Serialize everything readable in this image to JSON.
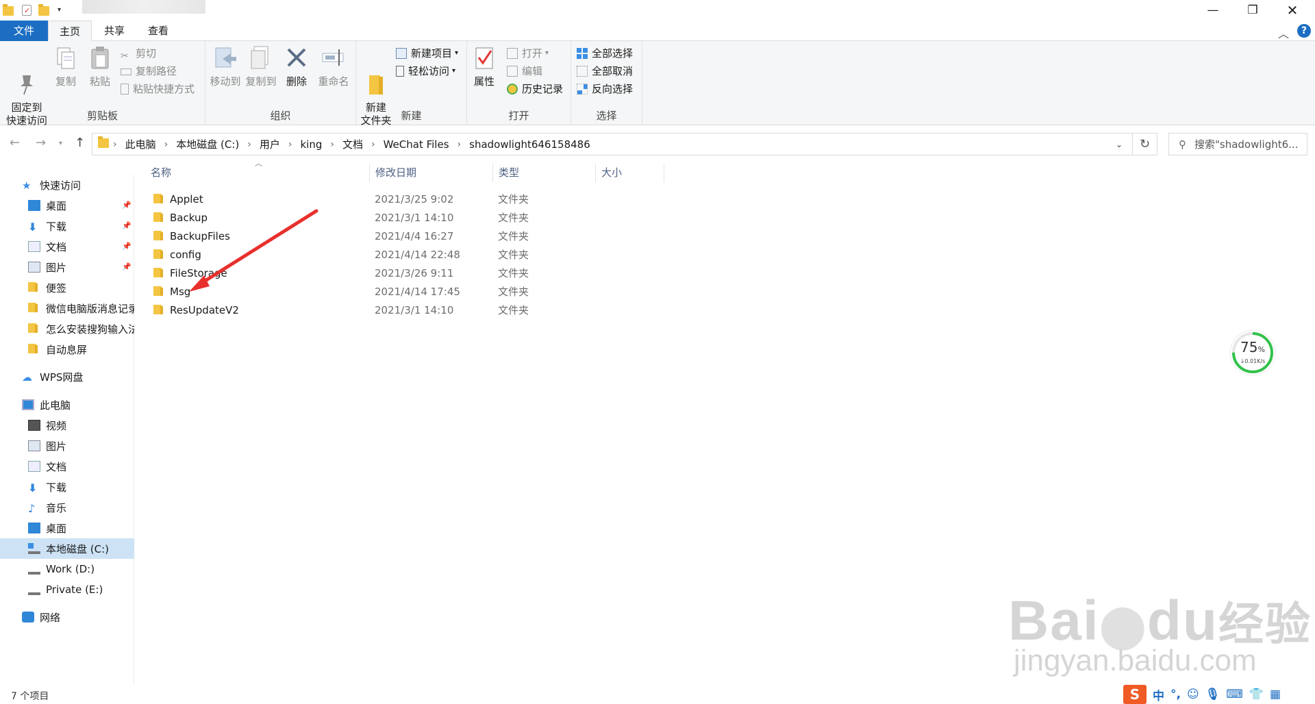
{
  "ribbon_tabs": {
    "file": "文件",
    "home": "主页",
    "share": "共享",
    "view": "查看"
  },
  "ribbon": {
    "clipboard": {
      "label": "剪贴板",
      "pin_quick_access": "固定到\n快速访问",
      "copy": "复制",
      "paste": "粘贴",
      "cut": "剪切",
      "copy_path": "复制路径",
      "paste_shortcut": "粘贴快捷方式"
    },
    "organize": {
      "label": "组织",
      "move_to": "移动到",
      "copy_to": "复制到",
      "delete": "删除",
      "rename": "重命名"
    },
    "new": {
      "label": "新建",
      "new_folder": "新建\n文件夹",
      "new_item": "新建项目",
      "easy_access": "轻松访问"
    },
    "open": {
      "label": "打开",
      "properties": "属性",
      "open": "打开",
      "edit": "编辑",
      "history": "历史记录"
    },
    "select": {
      "label": "选择",
      "select_all": "全部选择",
      "select_none": "全部取消",
      "invert": "反向选择"
    }
  },
  "address": {
    "breadcrumbs": [
      "此电脑",
      "本地磁盘 (C:)",
      "用户",
      "king",
      "文档",
      "WeChat Files",
      "shadowlight646158486"
    ],
    "search_placeholder": "搜索\"shadowlight6..."
  },
  "sidebar": {
    "quick_access": "快速访问",
    "quick_items": [
      "桌面",
      "下载",
      "文档",
      "图片",
      "便签",
      "微信电脑版消息记录",
      "怎么安装搜狗输入法",
      "自动息屏"
    ],
    "wps": "WPS网盘",
    "this_pc": "此电脑",
    "pc_items": [
      "视频",
      "图片",
      "文档",
      "下载",
      "音乐",
      "桌面",
      "本地磁盘 (C:)",
      "Work (D:)",
      "Private (E:)"
    ],
    "network": "网络"
  },
  "columns": {
    "name": "名称",
    "modified": "修改日期",
    "type": "类型",
    "size": "大小"
  },
  "files": [
    {
      "name": "Applet",
      "modified": "2021/3/25 9:02",
      "type": "文件夹"
    },
    {
      "name": "Backup",
      "modified": "2021/3/1 14:10",
      "type": "文件夹"
    },
    {
      "name": "BackupFiles",
      "modified": "2021/4/4 16:27",
      "type": "文件夹"
    },
    {
      "name": "config",
      "modified": "2021/4/14 22:48",
      "type": "文件夹"
    },
    {
      "name": "FileStorage",
      "modified": "2021/3/26 9:11",
      "type": "文件夹"
    },
    {
      "name": "Msg",
      "modified": "2021/4/14 17:45",
      "type": "文件夹"
    },
    {
      "name": "ResUpdateV2",
      "modified": "2021/3/1 14:10",
      "type": "文件夹"
    }
  ],
  "status": {
    "count": "7 个项目"
  },
  "net_widget": {
    "percent": "75",
    "unit": "%",
    "speed": "↓0.01K/s"
  },
  "watermark": {
    "brand": "Bai",
    "brand2": "du",
    "suffix": "经验",
    "url": "jingyan.baidu.com"
  },
  "ime": {
    "logo": "S",
    "lang": "中",
    "punct": "°,"
  },
  "colors": {
    "accent": "#1c6ec3",
    "selected": "#cde3f5",
    "folder": "#f4c542",
    "arrow": "#e8302c"
  }
}
